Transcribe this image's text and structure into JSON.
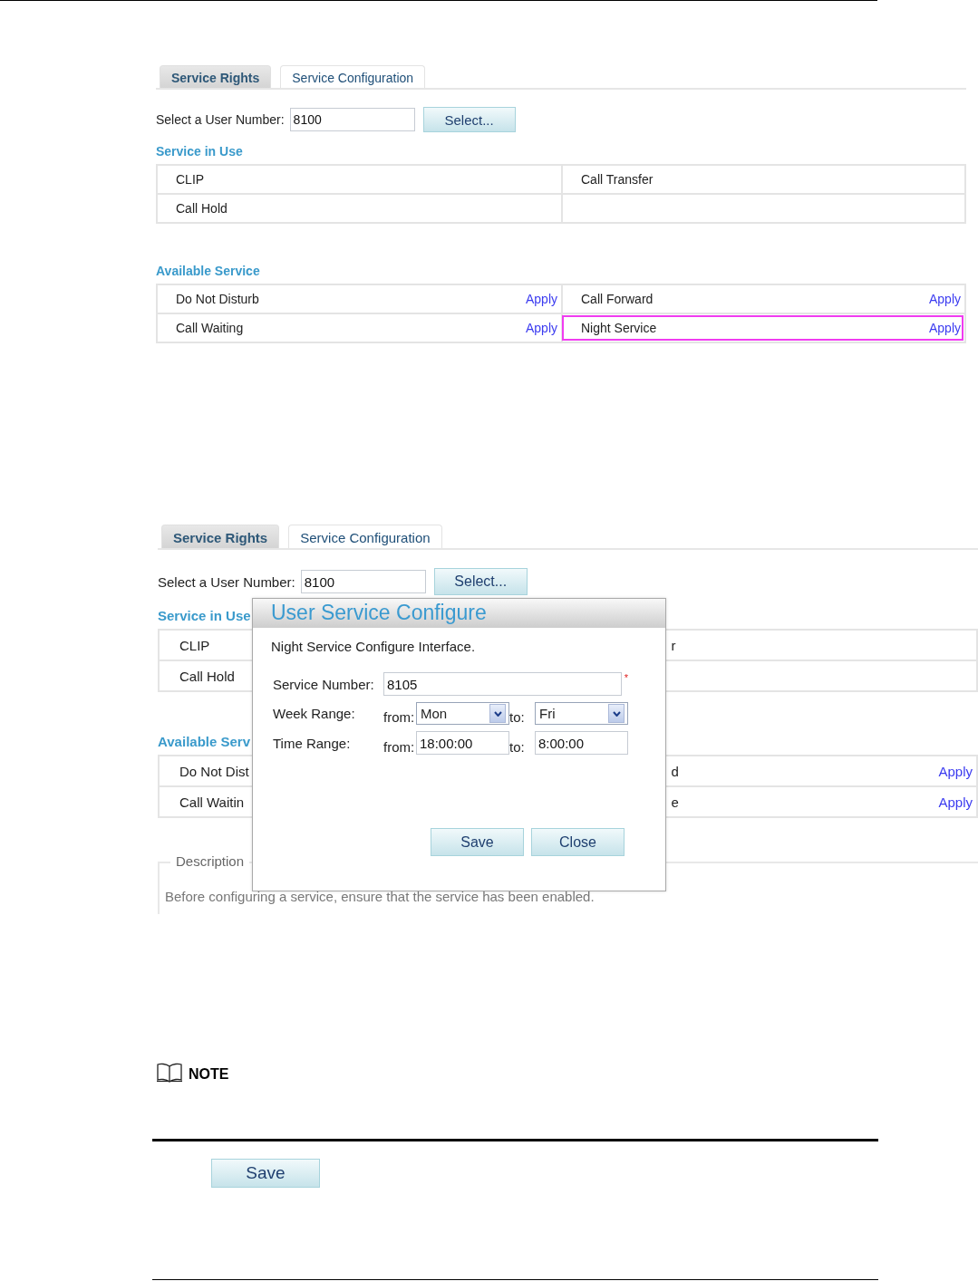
{
  "figure_1": {
    "tabs": [
      {
        "label": "Service Rights",
        "selected": false
      },
      {
        "label": "Service Configuration",
        "selected": true
      }
    ],
    "user_number": {
      "label": "Select a User Number:",
      "value": "8100",
      "button": "Select..."
    },
    "in_use": {
      "title": "Service in Use",
      "rows": [
        {
          "cells": [
            {
              "text": "CLIP"
            },
            {
              "text": "Call Transfer"
            }
          ]
        },
        {
          "cells": [
            {
              "text": "Call Hold"
            }
          ]
        }
      ]
    },
    "available": {
      "title": "Available Service",
      "rows": [
        {
          "cells": [
            {
              "text": "Do Not Disturb",
              "action": "Apply",
              "highlighted": false
            },
            {
              "text": "Call Forward",
              "action": "Apply",
              "highlighted": false
            }
          ]
        },
        {
          "cells": [
            {
              "text": "Call Waiting",
              "action": "Apply",
              "highlighted": false
            },
            {
              "text": "Night Service",
              "action": "Apply",
              "highlighted": true
            }
          ]
        }
      ]
    }
  },
  "figure_2": {
    "tabs": [
      {
        "label": "Service Rights",
        "selected": false
      },
      {
        "label": "Service Configuration",
        "selected": true
      }
    ],
    "user_number": {
      "label": "Select a User Number:",
      "value": "8100",
      "button": "Select..."
    },
    "in_use": {
      "title": "Service in Use",
      "rows": [
        {
          "cells": [
            {
              "text": "CLIP"
            },
            {
              "text": "r"
            }
          ]
        },
        {
          "cells": [
            {
              "text": "Call Hold"
            }
          ]
        }
      ]
    },
    "available": {
      "title": "Available Serv",
      "rows": [
        {
          "cells": [
            {
              "text": "Do Not Dist",
              "highlighted": false
            },
            {
              "text": "d",
              "action": "Apply",
              "highlighted": false
            }
          ]
        },
        {
          "cells": [
            {
              "text": "Call Waitin",
              "highlighted": false
            },
            {
              "text": "e",
              "action": "Apply",
              "highlighted": false
            }
          ]
        }
      ]
    },
    "description": {
      "legend": "Description",
      "text": "Before configuring a service, ensure that the service has been enabled."
    },
    "dialog": {
      "title": "User Service Configure",
      "intro": "Night Service Configure Interface.",
      "fields": [
        {
          "kind": "text",
          "label": "Service Number:",
          "value": "8105",
          "required_mark": "*"
        },
        {
          "kind": "select_range",
          "label": "Week Range:",
          "from_label": "from:",
          "from_value": "Mon",
          "to_label": "to:",
          "to_value": "Fri"
        },
        {
          "kind": "text_range",
          "label": "Time Range:",
          "from_label": "from:",
          "from_value": "18:00:00",
          "to_label": "to:",
          "to_value": "8:00:00"
        }
      ],
      "buttons": [
        "Save",
        "Close"
      ]
    }
  },
  "note": {
    "label": "NOTE"
  },
  "save_button": "Save"
}
